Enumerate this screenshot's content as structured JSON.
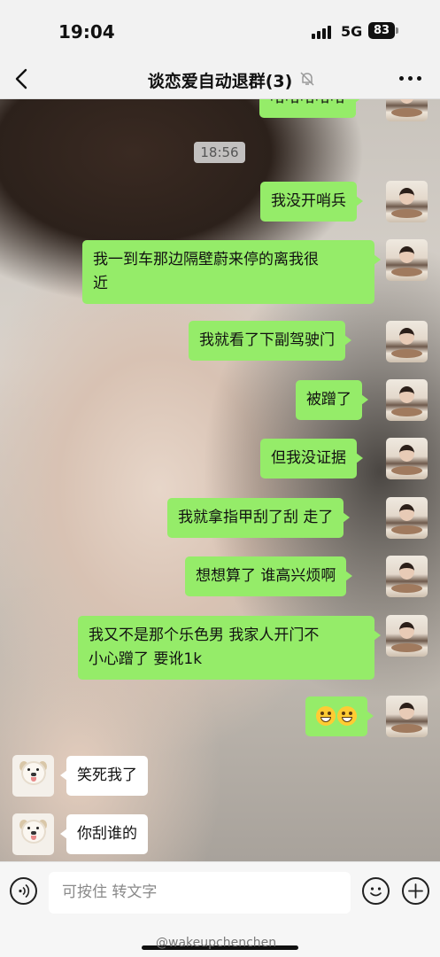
{
  "status": {
    "time": "19:04",
    "network": "5G",
    "battery": "83"
  },
  "header": {
    "title": "谈恋爱自动退群(3)",
    "icons": [
      "back-chevron-icon",
      "mute-bell-icon",
      "more-dots-icon"
    ]
  },
  "chat": {
    "partial_top_message": "哈哈哈哈哈",
    "timestamp": "18:56",
    "messages": [
      {
        "from": "me",
        "lines": [
          "我没开哨兵"
        ]
      },
      {
        "from": "me",
        "lines": [
          "我一到车那边隔壁蔚来停的离我很",
          "近"
        ]
      },
      {
        "from": "me",
        "lines": [
          "我就看了下副驾驶门"
        ]
      },
      {
        "from": "me",
        "lines": [
          "被蹭了"
        ]
      },
      {
        "from": "me",
        "lines": [
          "但我没证据"
        ]
      },
      {
        "from": "me",
        "lines": [
          "我就拿指甲刮了刮 走了"
        ]
      },
      {
        "from": "me",
        "lines": [
          "想想算了 谁高兴烦啊"
        ]
      },
      {
        "from": "me",
        "lines": [
          "我又不是那个乐色男 我家人开门不",
          "小心蹭了 要讹1k"
        ]
      },
      {
        "from": "me",
        "emoji": [
          "grin-emoji",
          "grin-emoji"
        ]
      },
      {
        "from": "other",
        "lines": [
          "笑死我了"
        ]
      },
      {
        "from": "other",
        "lines": [
          "你刮谁的"
        ]
      }
    ]
  },
  "input": {
    "placeholder": "可按住 转文字",
    "icons": [
      "voice-icon",
      "emoji-icon",
      "plus-icon"
    ]
  },
  "watermark": "@wakeupchenchen",
  "colors": {
    "bubble_out": "#95ec69",
    "bubble_in": "#ffffff",
    "bar_bg": "#f2f2f2"
  }
}
